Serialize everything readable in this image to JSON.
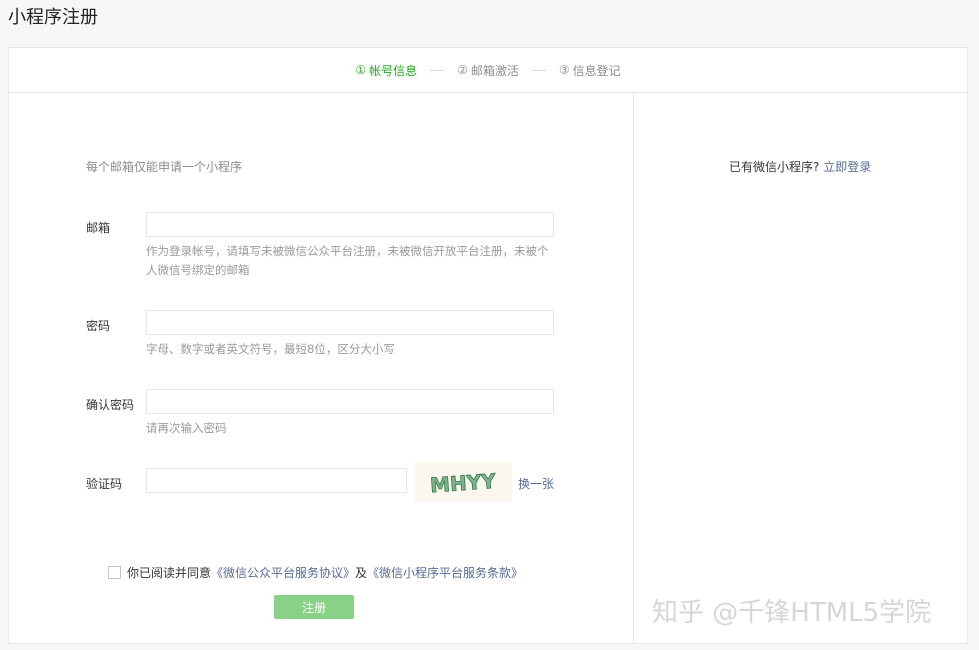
{
  "page": {
    "title": "小程序注册"
  },
  "steps": [
    {
      "num": "①",
      "label": "帐号信息"
    },
    {
      "num": "②",
      "label": "邮箱激活"
    },
    {
      "num": "③",
      "label": "信息登记"
    }
  ],
  "form": {
    "intro": "每个邮箱仅能申请一个小程序",
    "email": {
      "label": "邮箱",
      "value": "",
      "tip": "作为登录帐号，请填写未被微信公众平台注册，未被微信开放平台注册，未被个人微信号绑定的邮箱"
    },
    "password": {
      "label": "密码",
      "value": "",
      "tip": "字母、数字或者英文符号，最短8位，区分大小写"
    },
    "confirm": {
      "label": "确认密码",
      "value": "",
      "tip": "请再次输入密码"
    },
    "captcha": {
      "label": "验证码",
      "value": "",
      "image_text": "MHYY",
      "refresh": "换一张"
    },
    "agree": {
      "prefix": "你已阅读并同意",
      "link1": "《微信公众平台服务协议》",
      "and": "及",
      "link2": "《微信小程序平台服务条款》"
    },
    "submit": "注册"
  },
  "side": {
    "question": "已有微信小程序?",
    "login": "立即登录"
  },
  "watermark": "知乎 @千锋HTML5学院",
  "colors": {
    "accent": "#1aad19",
    "link": "#576b95",
    "button": "#88d187"
  }
}
